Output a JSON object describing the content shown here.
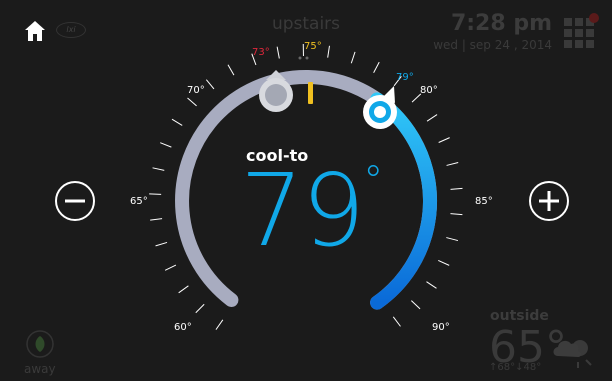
{
  "header": {
    "zone_name": "upstairs",
    "time": "7:28 pm",
    "date": "wed | sep 24 , 2014",
    "brand": "lxi"
  },
  "dial": {
    "mode": "cool-to",
    "setpoint": "79",
    "degree_symbol": "°",
    "heat_setpoint_label": "73°",
    "current_temp_label": "75°",
    "cool_setpoint_label": "79°",
    "scale_labels": [
      "60°",
      "65°",
      "70°",
      "80°",
      "85°",
      "90°"
    ],
    "colors": {
      "heat": "#e0283c",
      "current": "#f0c020",
      "cool": "#10a8e8",
      "track": "#a8acc0"
    }
  },
  "controls": {
    "minus_icon": "minus-circle-icon",
    "plus_icon": "plus-circle-icon",
    "home_icon": "home-icon",
    "menu_icon": "grid-menu-icon"
  },
  "outside": {
    "label": "outside",
    "temp": "65°",
    "hi_lo": "↑68°↓48°",
    "weather_icon": "partly-cloudy-night-icon"
  },
  "away": {
    "label": "away",
    "icon": "leaf-icon"
  }
}
